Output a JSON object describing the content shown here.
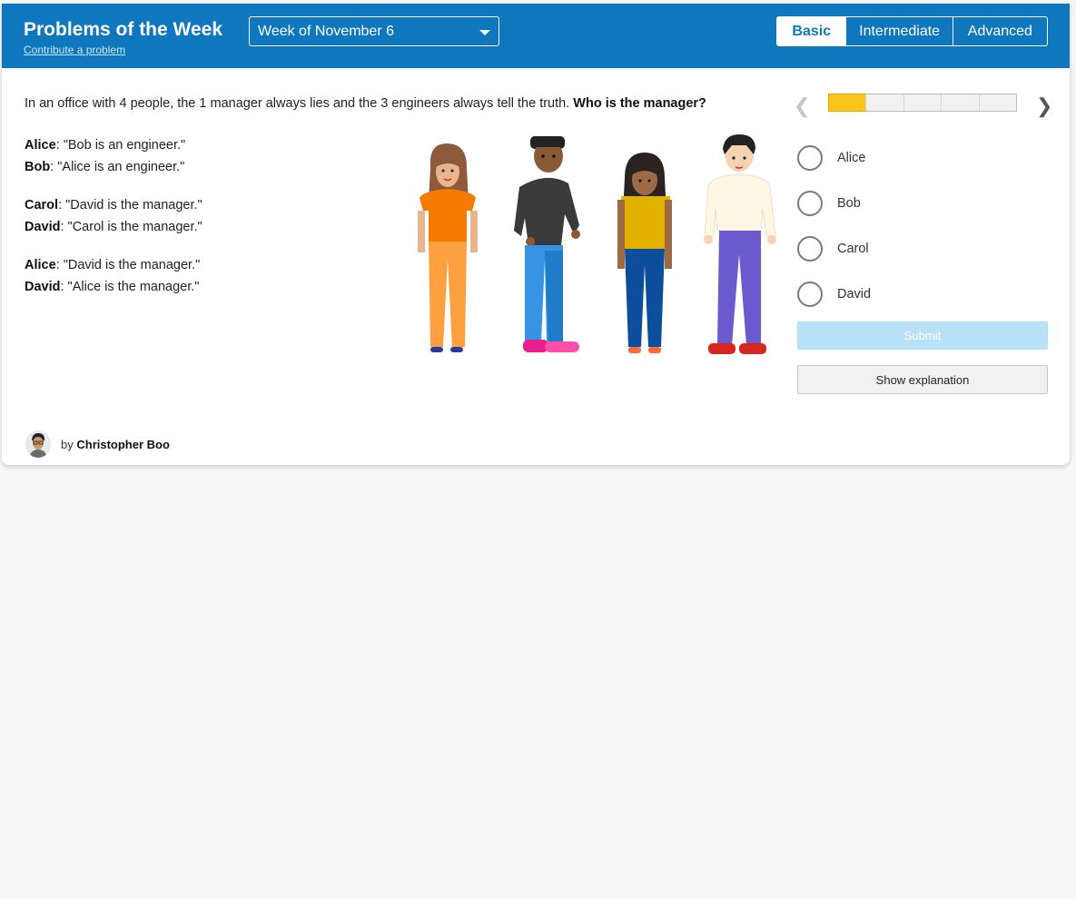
{
  "header": {
    "title": "Problems of the Week",
    "contribute_link": "Contribute a problem",
    "week_selector": {
      "selected": "Week of November 6"
    },
    "levels": [
      {
        "label": "Basic",
        "active": true
      },
      {
        "label": "Intermediate",
        "active": false
      },
      {
        "label": "Advanced",
        "active": false
      }
    ]
  },
  "problem": {
    "question_prefix": "In an office with 4 people, the 1 manager always lies and the 3 engineers always tell the truth.",
    "question_bold": "Who is the manager?",
    "statements": [
      {
        "speaker": "Alice",
        "quote": ": \"Bob is an engineer.\""
      },
      {
        "speaker": "Bob",
        "quote": ": \"Alice is an engineer.\""
      },
      {
        "speaker": "Carol",
        "quote": ": \"David is the manager.\""
      },
      {
        "speaker": "David",
        "quote": ": \"Carol is the manager.\""
      },
      {
        "speaker": "Alice",
        "quote": ": \"David is the manager.\""
      },
      {
        "speaker": "David",
        "quote": ": \"Alice is the manager.\""
      }
    ]
  },
  "navigation": {
    "prev_icon": "chevron-left-icon",
    "next_icon": "chevron-right-icon",
    "progress_current": 1,
    "progress_total": 5
  },
  "answers": {
    "options": [
      "Alice",
      "Bob",
      "Carol",
      "David"
    ],
    "submit_label": "Submit",
    "explanation_label": "Show explanation"
  },
  "author": {
    "prefix": "by",
    "name": "Christopher Boo"
  },
  "colors": {
    "header_blue": "#0f77bd",
    "progress_yellow": "#fcc419",
    "submit_disabled": "#b9e1f7"
  }
}
